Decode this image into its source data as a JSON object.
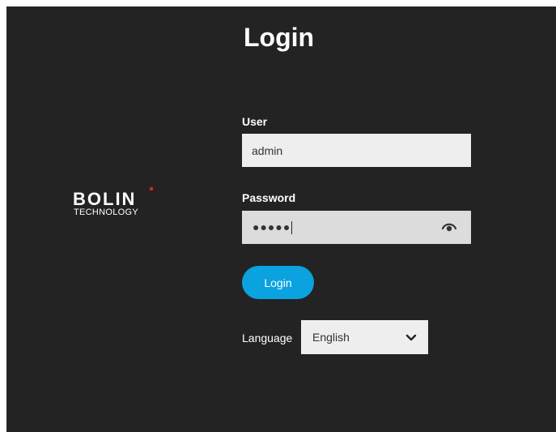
{
  "page": {
    "title": "Login"
  },
  "logo": {
    "brand": "BOLIN",
    "subtitle": "TECHNOLOGY"
  },
  "form": {
    "user_label": "User",
    "user_value": "admin",
    "password_label": "Password",
    "password_masked": "●●●●●",
    "login_label": "Login"
  },
  "language": {
    "label": "Language",
    "selected": "English"
  },
  "icons": {
    "password_toggle": "eye-icon",
    "dropdown": "chevron-down-icon"
  },
  "colors": {
    "background": "#232323",
    "accent": "#0aa3e0",
    "input_background": "#eeeeee",
    "text": "#ffffff",
    "logo_dot": "#e02020"
  }
}
